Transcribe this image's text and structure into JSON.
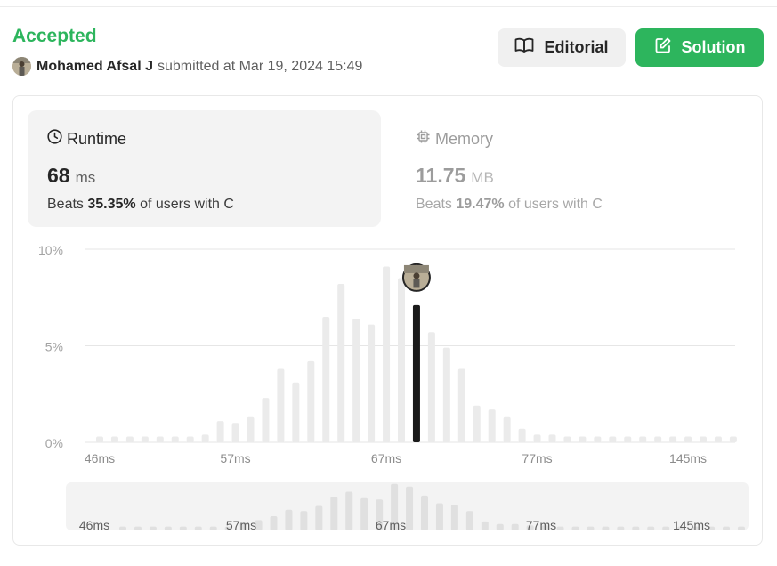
{
  "submission": {
    "status": "Accepted",
    "user": "Mohamed Afsal J",
    "submitted_text": "submitted at Mar 19, 2024 15:49"
  },
  "buttons": {
    "editorial": "Editorial",
    "solution": "Solution"
  },
  "runtime": {
    "label": "Runtime",
    "value": "68",
    "unit": "ms",
    "beats_prefix": "Beats",
    "beats_pct": "35.35%",
    "beats_suffix": "of users with C"
  },
  "memory": {
    "label": "Memory",
    "value": "11.75",
    "unit": "MB",
    "beats_prefix": "Beats",
    "beats_pct": "19.47%",
    "beats_suffix": "of users with C"
  },
  "colors": {
    "accent_green": "#2db55d",
    "bar": "#ebebeb",
    "bar_highlight": "#1a1a1a"
  },
  "icons": {
    "editorial": "book-icon",
    "solution": "edit-icon",
    "runtime": "clock-icon",
    "memory": "chip-icon",
    "avatar": "user-avatar",
    "marker": "user-avatar-marker"
  },
  "chart_data": {
    "type": "bar",
    "y_tick_labels": [
      "10%",
      "5%",
      "0%"
    ],
    "x_tick_labels": [
      "46ms",
      "57ms",
      "67ms",
      "77ms",
      "145ms"
    ],
    "ylim": [
      0,
      10
    ],
    "grid": true,
    "highlight_index": 21,
    "values": [
      0.3,
      0.3,
      0.3,
      0.3,
      0.3,
      0.3,
      0.3,
      0.4,
      1.1,
      1.0,
      1.3,
      2.3,
      3.8,
      3.1,
      4.2,
      6.5,
      8.2,
      6.4,
      6.1,
      9.1,
      8.5,
      7.1,
      5.7,
      4.9,
      3.8,
      1.9,
      1.7,
      1.3,
      0.7,
      0.4,
      0.4,
      0.3,
      0.3,
      0.3,
      0.3,
      0.3,
      0.3,
      0.3,
      0.3,
      0.3,
      0.3,
      0.3,
      0.3
    ],
    "navigator": {
      "x_tick_labels": [
        "46ms",
        "57ms",
        "67ms",
        "77ms",
        "145ms"
      ],
      "values": [
        0.3,
        0.3,
        0.3,
        0.3,
        0.3,
        0.3,
        0.3,
        0.3,
        0.6,
        0.8,
        1.1,
        1.6,
        1.5,
        1.9,
        2.6,
        3.0,
        2.5,
        2.4,
        3.6,
        3.4,
        2.7,
        2.1,
        2.0,
        1.5,
        0.7,
        0.5,
        0.5,
        0.4,
        0.4,
        0.3,
        0.3,
        0.3,
        0.3,
        0.3,
        0.3,
        0.3,
        0.3,
        0.3,
        0.3,
        0.3,
        0.3,
        0.3
      ]
    }
  }
}
